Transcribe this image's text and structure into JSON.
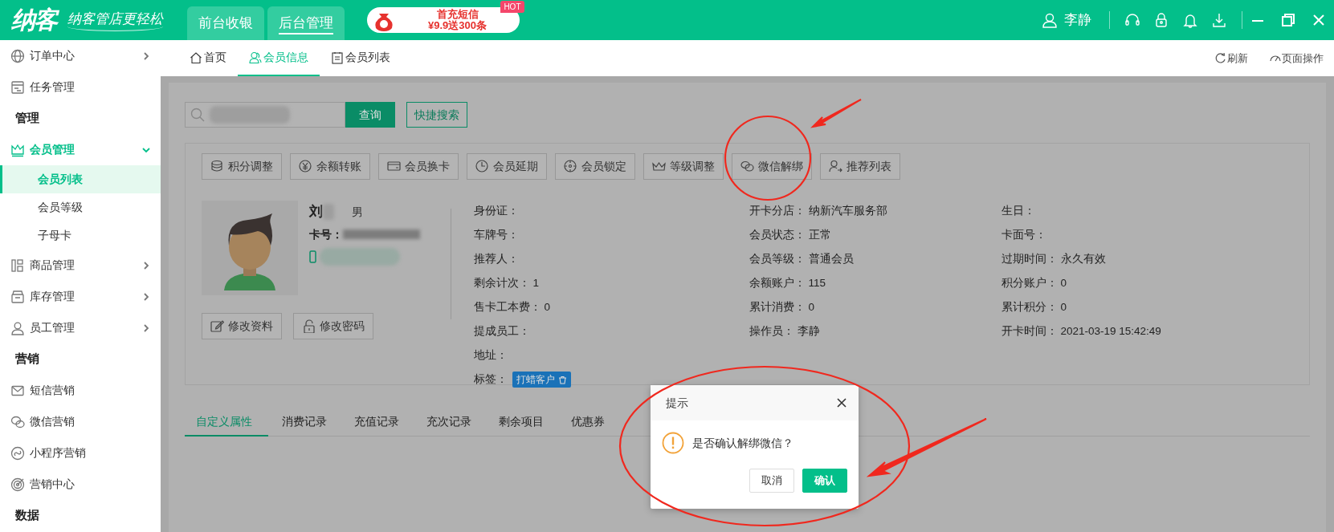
{
  "app": {
    "logo": "纳客",
    "slogan": "纳客管店更轻松"
  },
  "top_tabs": [
    {
      "label": "前台收银",
      "selected": false
    },
    {
      "label": "后台管理",
      "selected": true
    }
  ],
  "promo_banner": {
    "title": "首充短信",
    "offer": "¥9.9送300条",
    "badge": "HOT"
  },
  "user": {
    "name": "李静"
  },
  "sidebar": {
    "items": [
      {
        "kind": "item",
        "label": "订单中心",
        "expanded": false
      },
      {
        "kind": "item",
        "label": "任务管理"
      },
      {
        "kind": "section",
        "label": "管理"
      },
      {
        "kind": "item",
        "label": "会员管理",
        "expanded": true,
        "children": [
          {
            "label": "会员列表",
            "selected": true
          },
          {
            "label": "会员等级",
            "selected": false
          },
          {
            "label": "子母卡",
            "selected": false
          }
        ]
      },
      {
        "kind": "item",
        "label": "商品管理",
        "expanded": false
      },
      {
        "kind": "item",
        "label": "库存管理",
        "expanded": false
      },
      {
        "kind": "item",
        "label": "员工管理",
        "expanded": false
      },
      {
        "kind": "section",
        "label": "营销"
      },
      {
        "kind": "item",
        "label": "短信营销"
      },
      {
        "kind": "item",
        "label": "微信营销"
      },
      {
        "kind": "item",
        "label": "小程序营销"
      },
      {
        "kind": "item",
        "label": "营销中心"
      },
      {
        "kind": "section",
        "label": "数据"
      }
    ]
  },
  "page_tabs": [
    {
      "label": "首页",
      "selected": false
    },
    {
      "label": "会员信息",
      "selected": true
    },
    {
      "label": "会员列表",
      "selected": false
    }
  ],
  "page_actions": [
    "刷新",
    "页面操作"
  ],
  "search": {
    "button": "查询",
    "quick_search": "快捷搜索"
  },
  "member_actions": [
    "积分调整",
    "余额转账",
    "会员换卡",
    "会员延期",
    "会员锁定",
    "等级调整",
    "微信解绑",
    "推荐列表"
  ],
  "member": {
    "name": "刘",
    "gender": "男",
    "card_label": "卡号：",
    "edit_buttons": [
      "修改资料",
      "修改密码"
    ]
  },
  "info_columns": [
    [
      {
        "label": "身份证："
      },
      {
        "label": "车牌号："
      },
      {
        "label": "推荐人："
      },
      {
        "label": "剩余计次：",
        "value": "1"
      },
      {
        "label": "售卡工本费：",
        "value": "0"
      },
      {
        "label": "提成员工："
      },
      {
        "label": "地址："
      },
      {
        "label": "标签：",
        "tags": [
          "打蜡客户"
        ]
      }
    ],
    [
      {
        "label": "开卡分店：",
        "value": "纳新汽车服务部"
      },
      {
        "label": "会员状态：",
        "value": "正常"
      },
      {
        "label": "会员等级：",
        "value": "普通会员"
      },
      {
        "label": "余额账户：",
        "value": "115"
      },
      {
        "label": "累计消费：",
        "value": "0"
      },
      {
        "label": "操作员：",
        "value": "李静"
      }
    ],
    [
      {
        "label": "生日："
      },
      {
        "label": "卡面号："
      },
      {
        "label": "过期时间：",
        "value": "永久有效"
      },
      {
        "label": "积分账户：",
        "value": "0"
      },
      {
        "label": "累计积分：",
        "value": "0"
      },
      {
        "label": "开卡时间：",
        "value": "2021-03-19 15:42:49"
      }
    ]
  ],
  "record_tabs": [
    {
      "label": "自定义属性",
      "selected": true
    },
    {
      "label": "消费记录",
      "selected": false
    },
    {
      "label": "充值记录",
      "selected": false
    },
    {
      "label": "充次记录",
      "selected": false
    },
    {
      "label": "剩余项目",
      "selected": false
    },
    {
      "label": "优惠券",
      "selected": false
    }
  ],
  "dialog": {
    "title": "提示",
    "message": "是否确认解绑微信？",
    "buttons": [
      {
        "label": "取消",
        "kind": "default"
      },
      {
        "label": "确认",
        "kind": "primary"
      }
    ]
  }
}
